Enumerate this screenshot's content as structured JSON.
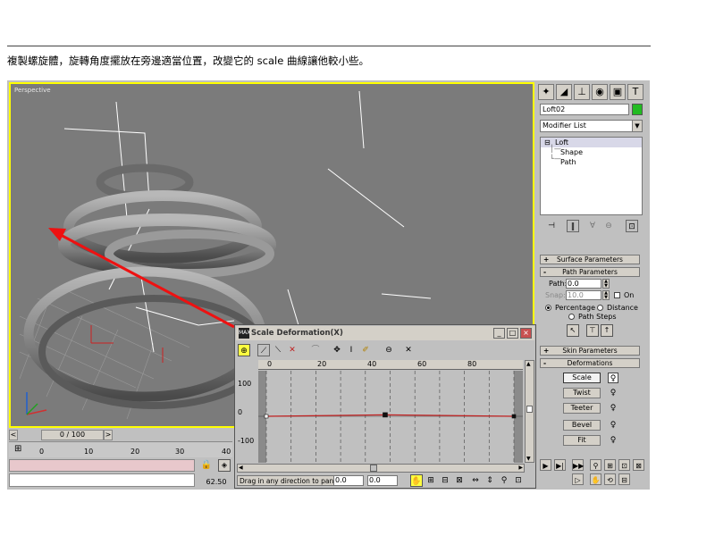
{
  "caption": "複製螺旋體，旋轉角度擺放在旁邊適當位置，改變它的 scale 曲線讓他較小些。",
  "viewport": {
    "label": "Perspective"
  },
  "time": {
    "frame": "0 / 100",
    "left_arrow": "<",
    "right_arrow": ">"
  },
  "track": {
    "ticks": [
      "0",
      "10",
      "20",
      "30",
      "40"
    ]
  },
  "status": {
    "coord_value": "62.50"
  },
  "command_panel": {
    "tabs": [
      "create-icon",
      "modify-icon",
      "hierarchy-icon",
      "motion-icon",
      "display-icon",
      "utilities-icon"
    ],
    "object_name": "Loft02",
    "object_color": "#22bb22",
    "modifier_list": "Modifier List",
    "stack": {
      "root": "Loft",
      "children": [
        "Shape",
        "Path"
      ]
    },
    "rollouts": {
      "surface": "Surface Parameters",
      "path": "Path Parameters",
      "skin": "Skin Parameters",
      "deform": "Deformations"
    },
    "signs": {
      "plus": "+",
      "minus": "-"
    },
    "path_params": {
      "path_label": "Path:",
      "path_value": "0.0",
      "snap_label": "Snap:",
      "snap_value": "10.0",
      "on_label": "On",
      "percentage": "Percentage",
      "distance": "Distance",
      "path_steps": "Path Steps"
    },
    "deformations": [
      "Scale",
      "Twist",
      "Teeter",
      "Bevel",
      "Fit"
    ]
  },
  "scale_window": {
    "title": "Scale Deformation(X)",
    "app_icon": "MAX",
    "ruler": [
      "0",
      "20",
      "40",
      "60",
      "80"
    ],
    "y_labels": [
      "100",
      "0",
      "-100"
    ],
    "status": "Drag in any direction to pan Ec",
    "x_value": "0.0",
    "y_value": "0.0",
    "curve_points": [
      [
        0,
        0
      ],
      [
        48,
        5
      ],
      [
        100,
        0
      ]
    ],
    "curve_color": "#c02020"
  },
  "colors": {
    "viewport_border": "#ffff00",
    "arrow": "#ee1111",
    "viewport_bg": "#7b7b7b"
  }
}
